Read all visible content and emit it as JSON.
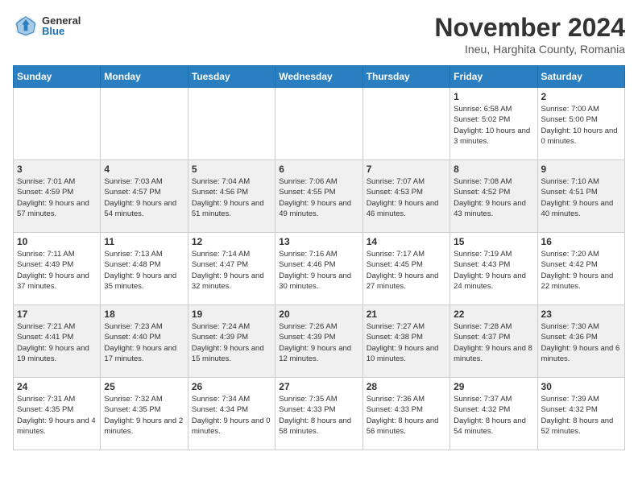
{
  "logo": {
    "general": "General",
    "blue": "Blue"
  },
  "title": "November 2024",
  "subtitle": "Ineu, Harghita County, Romania",
  "days_of_week": [
    "Sunday",
    "Monday",
    "Tuesday",
    "Wednesday",
    "Thursday",
    "Friday",
    "Saturday"
  ],
  "weeks": [
    [
      {
        "day": "",
        "info": ""
      },
      {
        "day": "",
        "info": ""
      },
      {
        "day": "",
        "info": ""
      },
      {
        "day": "",
        "info": ""
      },
      {
        "day": "",
        "info": ""
      },
      {
        "day": "1",
        "info": "Sunrise: 6:58 AM\nSunset: 5:02 PM\nDaylight: 10 hours and 3 minutes."
      },
      {
        "day": "2",
        "info": "Sunrise: 7:00 AM\nSunset: 5:00 PM\nDaylight: 10 hours and 0 minutes."
      }
    ],
    [
      {
        "day": "3",
        "info": "Sunrise: 7:01 AM\nSunset: 4:59 PM\nDaylight: 9 hours and 57 minutes."
      },
      {
        "day": "4",
        "info": "Sunrise: 7:03 AM\nSunset: 4:57 PM\nDaylight: 9 hours and 54 minutes."
      },
      {
        "day": "5",
        "info": "Sunrise: 7:04 AM\nSunset: 4:56 PM\nDaylight: 9 hours and 51 minutes."
      },
      {
        "day": "6",
        "info": "Sunrise: 7:06 AM\nSunset: 4:55 PM\nDaylight: 9 hours and 49 minutes."
      },
      {
        "day": "7",
        "info": "Sunrise: 7:07 AM\nSunset: 4:53 PM\nDaylight: 9 hours and 46 minutes."
      },
      {
        "day": "8",
        "info": "Sunrise: 7:08 AM\nSunset: 4:52 PM\nDaylight: 9 hours and 43 minutes."
      },
      {
        "day": "9",
        "info": "Sunrise: 7:10 AM\nSunset: 4:51 PM\nDaylight: 9 hours and 40 minutes."
      }
    ],
    [
      {
        "day": "10",
        "info": "Sunrise: 7:11 AM\nSunset: 4:49 PM\nDaylight: 9 hours and 37 minutes."
      },
      {
        "day": "11",
        "info": "Sunrise: 7:13 AM\nSunset: 4:48 PM\nDaylight: 9 hours and 35 minutes."
      },
      {
        "day": "12",
        "info": "Sunrise: 7:14 AM\nSunset: 4:47 PM\nDaylight: 9 hours and 32 minutes."
      },
      {
        "day": "13",
        "info": "Sunrise: 7:16 AM\nSunset: 4:46 PM\nDaylight: 9 hours and 30 minutes."
      },
      {
        "day": "14",
        "info": "Sunrise: 7:17 AM\nSunset: 4:45 PM\nDaylight: 9 hours and 27 minutes."
      },
      {
        "day": "15",
        "info": "Sunrise: 7:19 AM\nSunset: 4:43 PM\nDaylight: 9 hours and 24 minutes."
      },
      {
        "day": "16",
        "info": "Sunrise: 7:20 AM\nSunset: 4:42 PM\nDaylight: 9 hours and 22 minutes."
      }
    ],
    [
      {
        "day": "17",
        "info": "Sunrise: 7:21 AM\nSunset: 4:41 PM\nDaylight: 9 hours and 19 minutes."
      },
      {
        "day": "18",
        "info": "Sunrise: 7:23 AM\nSunset: 4:40 PM\nDaylight: 9 hours and 17 minutes."
      },
      {
        "day": "19",
        "info": "Sunrise: 7:24 AM\nSunset: 4:39 PM\nDaylight: 9 hours and 15 minutes."
      },
      {
        "day": "20",
        "info": "Sunrise: 7:26 AM\nSunset: 4:39 PM\nDaylight: 9 hours and 12 minutes."
      },
      {
        "day": "21",
        "info": "Sunrise: 7:27 AM\nSunset: 4:38 PM\nDaylight: 9 hours and 10 minutes."
      },
      {
        "day": "22",
        "info": "Sunrise: 7:28 AM\nSunset: 4:37 PM\nDaylight: 9 hours and 8 minutes."
      },
      {
        "day": "23",
        "info": "Sunrise: 7:30 AM\nSunset: 4:36 PM\nDaylight: 9 hours and 6 minutes."
      }
    ],
    [
      {
        "day": "24",
        "info": "Sunrise: 7:31 AM\nSunset: 4:35 PM\nDaylight: 9 hours and 4 minutes."
      },
      {
        "day": "25",
        "info": "Sunrise: 7:32 AM\nSunset: 4:35 PM\nDaylight: 9 hours and 2 minutes."
      },
      {
        "day": "26",
        "info": "Sunrise: 7:34 AM\nSunset: 4:34 PM\nDaylight: 9 hours and 0 minutes."
      },
      {
        "day": "27",
        "info": "Sunrise: 7:35 AM\nSunset: 4:33 PM\nDaylight: 8 hours and 58 minutes."
      },
      {
        "day": "28",
        "info": "Sunrise: 7:36 AM\nSunset: 4:33 PM\nDaylight: 8 hours and 56 minutes."
      },
      {
        "day": "29",
        "info": "Sunrise: 7:37 AM\nSunset: 4:32 PM\nDaylight: 8 hours and 54 minutes."
      },
      {
        "day": "30",
        "info": "Sunrise: 7:39 AM\nSunset: 4:32 PM\nDaylight: 8 hours and 52 minutes."
      }
    ]
  ]
}
